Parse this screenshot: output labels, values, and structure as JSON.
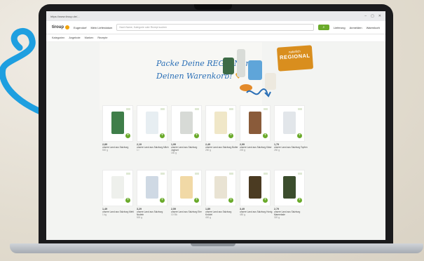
{
  "browser": {
    "url": "https://www.tiroup.de/...",
    "controls": [
      "–",
      "▢",
      "✕"
    ]
  },
  "header": {
    "logo": "tiroup",
    "store_link": "Eugendorf",
    "delivery_link": "Mein Lieferdatum",
    "search_placeholder": "Nach Name, Kategorie oder Rezept suchen",
    "account_label": "Anmelden",
    "cart_label": "Warenkorb",
    "favorites_label": "Lieferung"
  },
  "catnav": [
    "Kategorien",
    "Angebote",
    "Marken",
    "Rezepte"
  ],
  "banner": {
    "line1": "Packe Deine REGION in",
    "line2": "Deinen Warenkorb!",
    "badge_small": "naturlich",
    "badge_big": "REGIONAL"
  },
  "products": [
    {
      "price": "2,89",
      "name": "unsere Land aus Salzburg",
      "qty": "500 g"
    },
    {
      "price": "2,19",
      "name": "unsere Land aus Salzburg Milch",
      "qty": "1 l"
    },
    {
      "price": "1,99",
      "name": "unsere Land aus Salzburg Joghurt",
      "qty": "150 g"
    },
    {
      "price": "2,49",
      "name": "unsere Land aus Salzburg Butter",
      "qty": "250 g"
    },
    {
      "price": "2,99",
      "name": "unsere Land aus Salzburg Käse",
      "qty": "200 g"
    },
    {
      "price": "1,79",
      "name": "unsere Land aus Salzburg Topfen",
      "qty": "250 g"
    },
    {
      "price": "1,49",
      "name": "unsere Land aus Salzburg Mehl",
      "qty": "1 kg"
    },
    {
      "price": "3,29",
      "name": "unsere Land aus Salzburg Nudeln",
      "qty": "500 g"
    },
    {
      "price": "2,59",
      "name": "unsere Land aus Salzburg Eier",
      "qty": "10 Stk"
    },
    {
      "price": "1,89",
      "name": "unsere Land aus Salzburg Knödel",
      "qty": "400 g"
    },
    {
      "price": "3,49",
      "name": "unsere Land aus Salzburg Honig",
      "qty": "450 g"
    },
    {
      "price": "2,79",
      "name": "unsere Land aus Salzburg Marmelade",
      "qty": "320 g"
    }
  ],
  "colors": {
    "brand_green": "#6aaa2a",
    "headline_blue": "#2a6fb6",
    "regional_orange": "#d98e1e",
    "arrow_blue": "#1e9fe0"
  }
}
